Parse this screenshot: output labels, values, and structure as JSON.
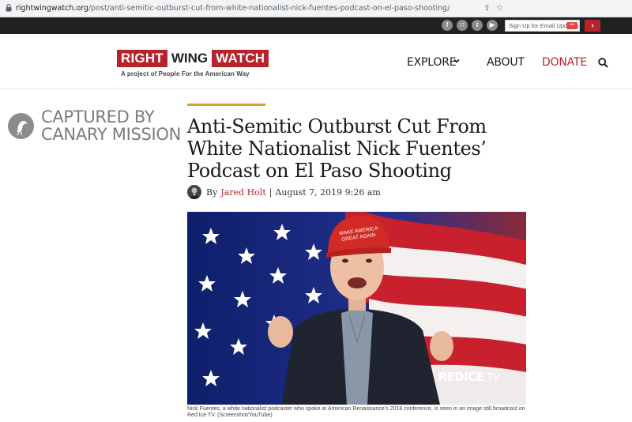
{
  "browser": {
    "url_domain": "rightwingwatch.org",
    "url_path": "/post/anti-semitic-outburst-cut-from-white-nationalist-nick-fuentes-podcast-on-el-paso-shooting/"
  },
  "topbar": {
    "social_icons": [
      "facebook-icon",
      "rss-icon",
      "twitter-icon",
      "youtube-icon"
    ],
    "social_glyphs": [
      "f",
      "∷",
      "t",
      "▶"
    ],
    "email_placeholder": "Sign Up for Email Updates",
    "submit_glyph": "›"
  },
  "header": {
    "logo_right": "RIGHT",
    "logo_wing": "WING",
    "logo_watch": "WATCH",
    "tagline": "A project of People For the American Way",
    "nav": {
      "explore": "EXPLORE",
      "about": "ABOUT",
      "donate": "DONATE"
    }
  },
  "watermark": {
    "line1": "CAPTURED BY",
    "line2": "CANARY MISSION"
  },
  "article": {
    "title": "Anti-Semitic Outburst Cut From White Nationalist Nick Fuentes’ Podcast on El Paso Shooting",
    "by": "By",
    "author": "Jared Holt",
    "separator": "|",
    "date": "August 7, 2019 9:26 am",
    "image_watermark_main": "REDICE",
    "image_watermark_tv": ".TV",
    "hat_text": "MAKE AMERICA GREAT AGAIN",
    "caption": "Nick Fuentes, a white nationalist podcaster who spoke at American Renaissance’s 2018 conference, is seen in an image still broadcast on Red Ice TV. (Screenshot/YouTube)"
  },
  "colors": {
    "brand_red": "#b7232a",
    "accent_gold": "#d8a531",
    "topbar_dark": "#212121"
  }
}
